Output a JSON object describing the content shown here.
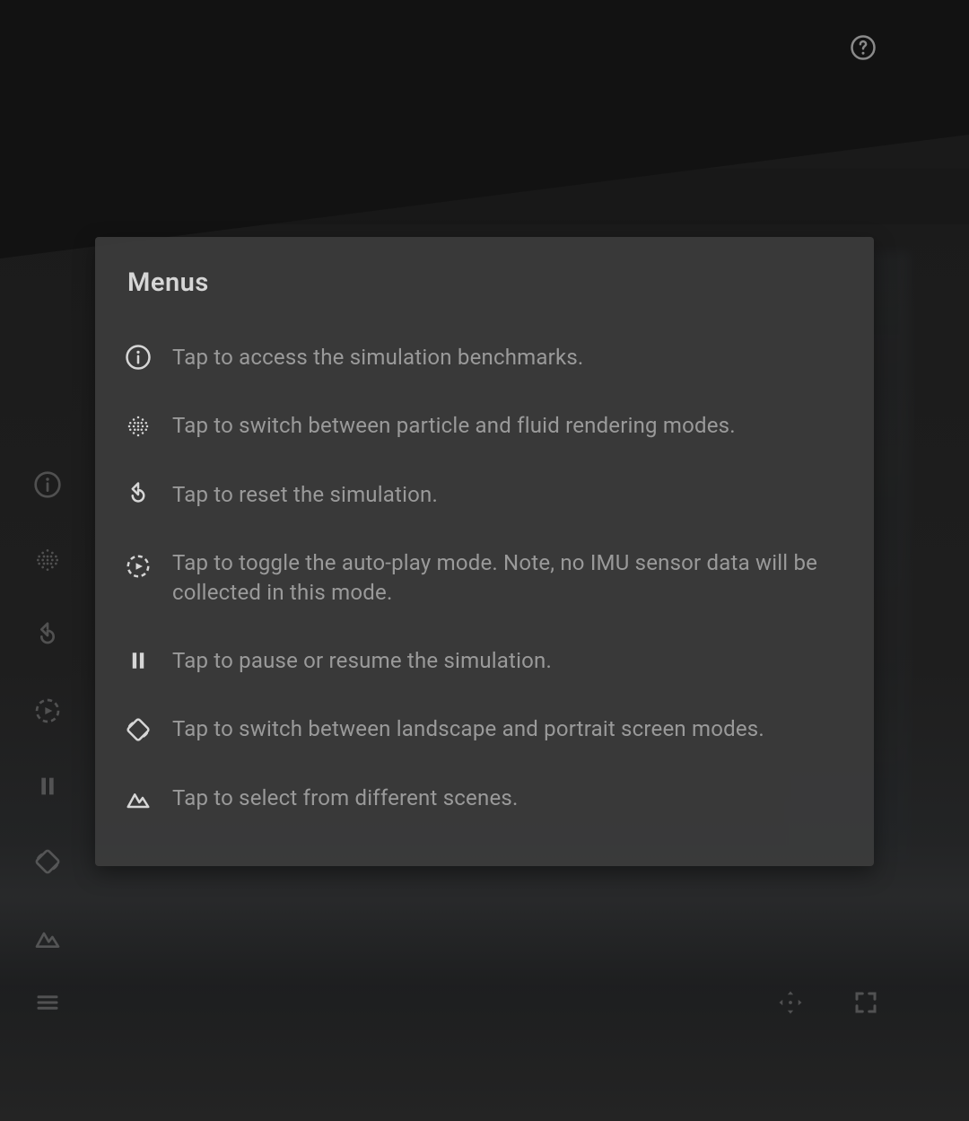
{
  "popover": {
    "title": "Menus",
    "items": [
      {
        "icon": "info-icon",
        "text": "Tap to access the simulation benchmarks."
      },
      {
        "icon": "particles-icon",
        "text": "Tap to switch between particle and fluid rendering modes."
      },
      {
        "icon": "reset-icon",
        "text": "Tap to reset the simulation."
      },
      {
        "icon": "autoplay-icon",
        "text": "Tap to toggle the auto-play mode. Note, no IMU sensor data will be collected in this mode."
      },
      {
        "icon": "pause-icon",
        "text": "Tap to pause or resume the simulation."
      },
      {
        "icon": "rotate-icon",
        "text": "Tap to switch between landscape and portrait screen modes."
      },
      {
        "icon": "scene-icon",
        "text": "Tap to select from different scenes."
      }
    ]
  },
  "sidebar_icons": [
    "info-icon",
    "particles-icon",
    "reset-icon",
    "autoplay-icon",
    "pause-icon",
    "rotate-icon",
    "scene-icon"
  ],
  "bottom_left_icon": "menu-icon",
  "bottom_right_icons": [
    "move-icon",
    "fullscreen-icon"
  ],
  "top_right_icon": "help-icon"
}
